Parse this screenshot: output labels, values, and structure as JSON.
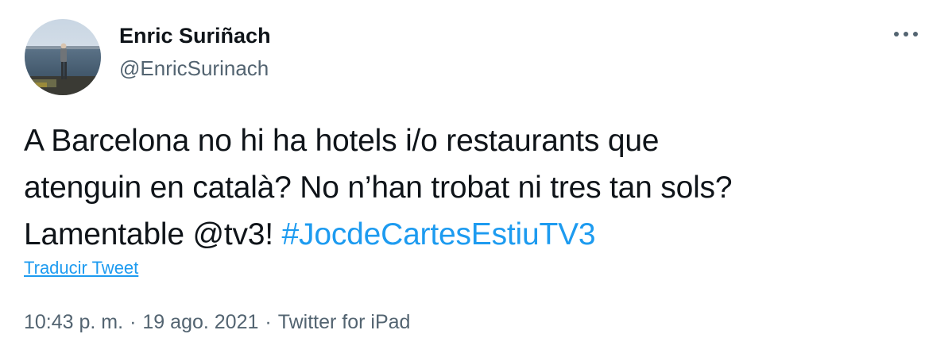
{
  "author": {
    "display_name": "Enric Suriñach",
    "handle": "@EnricSurinach",
    "avatar": "avatar-photo-person-by-sea"
  },
  "more_icon": "more-horizontal-icon",
  "tweet": {
    "line1": "A Barcelona no hi ha hotels i/o restaurants que",
    "line2": "atenguin en català? No n’han trobat ni tres tan sols?",
    "line3_prefix": "Lamentable @tv3! ",
    "hashtag": "#JocdeCartesEstiuTV3"
  },
  "translate_label": "Traducir Tweet",
  "meta": {
    "time": "10:43 p. m.",
    "separator": "·",
    "date": "19 ago. 2021",
    "source": "Twitter for iPad"
  },
  "colors": {
    "link": "#1d9bf0",
    "secondary_text": "#536471",
    "primary_text": "#0f1419"
  }
}
